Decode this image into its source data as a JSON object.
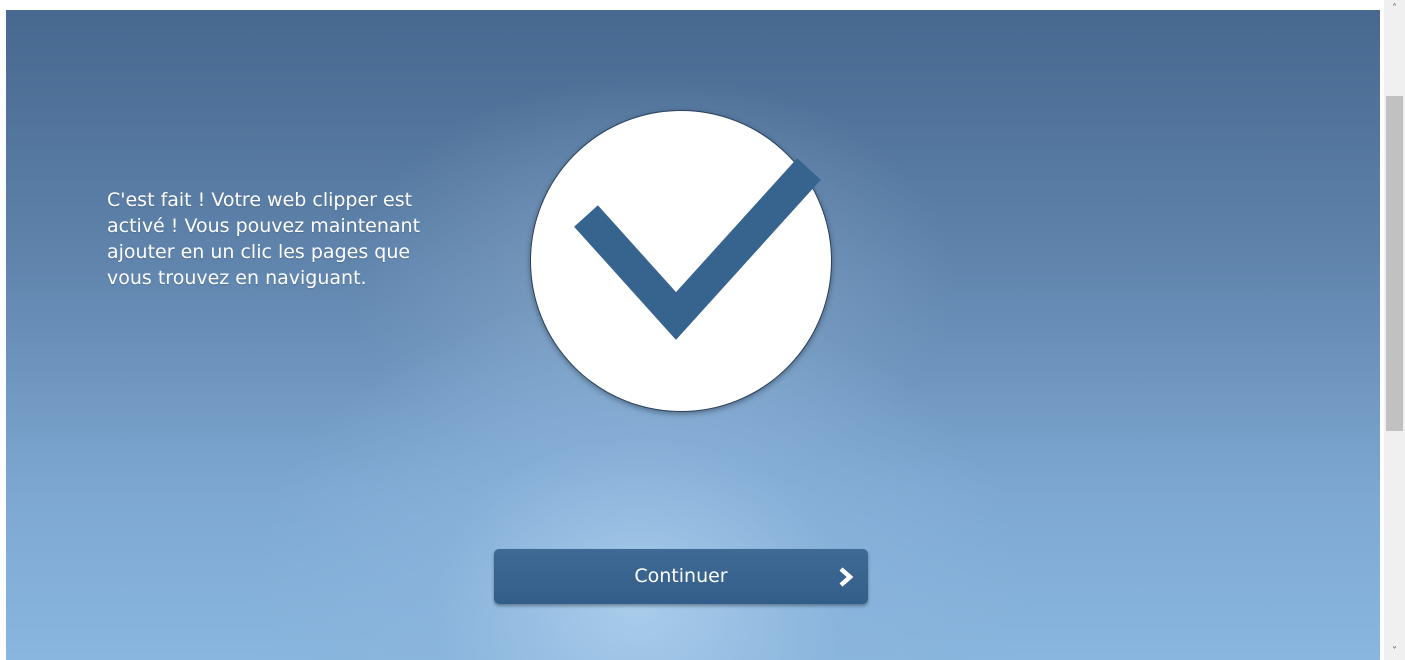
{
  "message": {
    "line1": "C'est fait ! Votre web clipper est",
    "line2": "activé ! Vous pouvez maintenant",
    "line3": "ajouter en un clic les pages que",
    "line4": "vous trouvez en naviguant."
  },
  "continue_button": {
    "label": "Continuer",
    "icon": "chevron-right-icon"
  },
  "checkmark": {
    "icon": "checkmark-icon"
  },
  "scrollbar": {
    "up_glyph": "˄",
    "down_glyph": "˅"
  },
  "colors": {
    "accent": "#37638f",
    "circle": "#ffffff",
    "text": "#ffffff"
  }
}
